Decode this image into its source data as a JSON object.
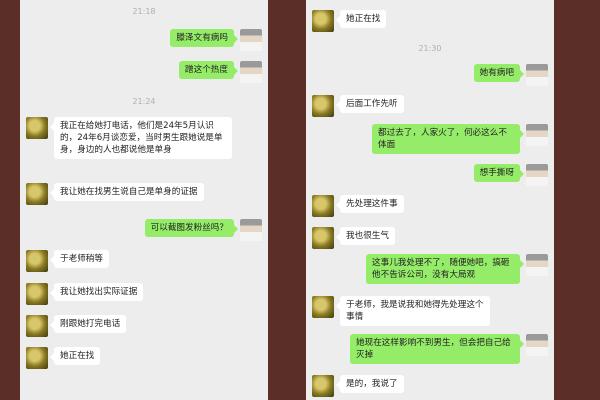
{
  "left": {
    "times": [
      "21:18",
      "21:24"
    ],
    "messages": [
      {
        "side": "right",
        "text": "滕泽文有病吗"
      },
      {
        "side": "right",
        "text": "蹭这个热度"
      },
      {
        "side": "left",
        "text": "我正在给她打电话，他们是24年5月认识的，24年6月谈恋爱，当时男生跟她说是单身，身边的人也都说他是单身"
      },
      {
        "side": "left",
        "text": "我让她在找男生说自己是单身的证据"
      },
      {
        "side": "right",
        "text": "可以截图发粉丝吗？"
      },
      {
        "side": "left",
        "text": "于老师稍等"
      },
      {
        "side": "left",
        "text": "我让她找出实际证据"
      },
      {
        "side": "left",
        "text": "刚跟她打完电话"
      },
      {
        "side": "left",
        "text": "她正在找"
      }
    ]
  },
  "right": {
    "times": [
      "21:30"
    ],
    "messages": [
      {
        "side": "left",
        "text": "她正在找"
      },
      {
        "side": "right",
        "text": "她有病吧"
      },
      {
        "side": "left",
        "text": "后面工作先听"
      },
      {
        "side": "right",
        "text": "都过去了，人家火了，何必这么不体面"
      },
      {
        "side": "right",
        "text": "想手撕呀"
      },
      {
        "side": "left",
        "text": "先处理这件事"
      },
      {
        "side": "left",
        "text": "我也很生气"
      },
      {
        "side": "right",
        "text": "这事儿我处理不了，随便她吧，搞砸他不告诉公司，没有大局观"
      },
      {
        "side": "left",
        "text": "于老师，我是说我和她得先处理这个事情"
      },
      {
        "side": "right",
        "text": "她现在这样影响不到男生，但会把自己给灭掉"
      },
      {
        "side": "left",
        "text": "是的，我说了"
      }
    ]
  }
}
